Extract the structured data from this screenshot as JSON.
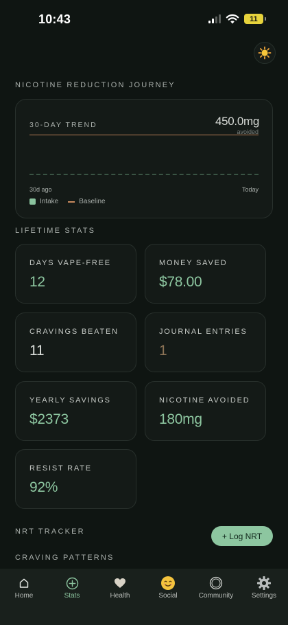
{
  "status_bar": {
    "time": "10:43",
    "battery": "11"
  },
  "sections": {
    "journey": "NICOTINE REDUCTION JOURNEY",
    "lifetime": "LIFETIME STATS",
    "nrt": "NRT TRACKER",
    "cravings": "CRAVING PATTERNS"
  },
  "trend": {
    "label": "30-DAY TREND",
    "value": "450.0mg",
    "value_sub": "avoided",
    "axis_start": "30d ago",
    "axis_end": "Today",
    "legend_intake": "Intake",
    "legend_baseline": "Baseline",
    "colors": {
      "intake": "#8ac39e",
      "baseline": "#c98a5e"
    }
  },
  "stats": [
    {
      "label": "DAYS VAPE-FREE",
      "value": "12",
      "color": "#8dc6a0"
    },
    {
      "label": "MONEY SAVED",
      "value": "$78.00",
      "color": "#8dc6a0"
    },
    {
      "label": "CRAVINGS BEATEN",
      "value": "11",
      "color": "#dcdfdb"
    },
    {
      "label": "JOURNAL ENTRIES",
      "value": "1",
      "color": "#8c7356"
    },
    {
      "label": "YEARLY SAVINGS",
      "value": "$2373",
      "color": "#8dc6a0"
    },
    {
      "label": "NICOTINE AVOIDED",
      "value": "180mg",
      "color": "#8dc6a0"
    },
    {
      "label": "RESIST RATE",
      "value": "92%",
      "color": "#8dc6a0"
    }
  ],
  "log_nrt_button": "+ Log NRT",
  "nav": [
    {
      "label": "Home",
      "icon": "home-icon"
    },
    {
      "label": "Stats",
      "icon": "stats-plus-icon",
      "active": true
    },
    {
      "label": "Health",
      "icon": "heart-icon"
    },
    {
      "label": "Social",
      "icon": "smiley-icon"
    },
    {
      "label": "Community",
      "icon": "circle-icon"
    },
    {
      "label": "Settings",
      "icon": "gear-icon"
    }
  ]
}
